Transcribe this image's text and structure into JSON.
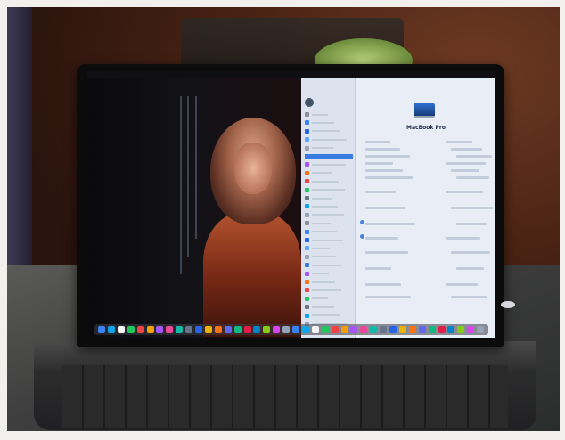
{
  "photo": {
    "laptop": {
      "screen": {
        "settings_window": {
          "main": {
            "device_title": "MacBook Pro"
          },
          "sidebar": {
            "item_count": 26,
            "selected_index": 5
          }
        },
        "dock": {
          "icon_count": 40
        }
      }
    }
  },
  "colors": {
    "wood": "#4a2314",
    "table_glass": "#3e3f3e",
    "screen_bg": "#0c0c0e",
    "settings_bg": "#e9eef6",
    "accent_blue": "#3a7be0"
  }
}
